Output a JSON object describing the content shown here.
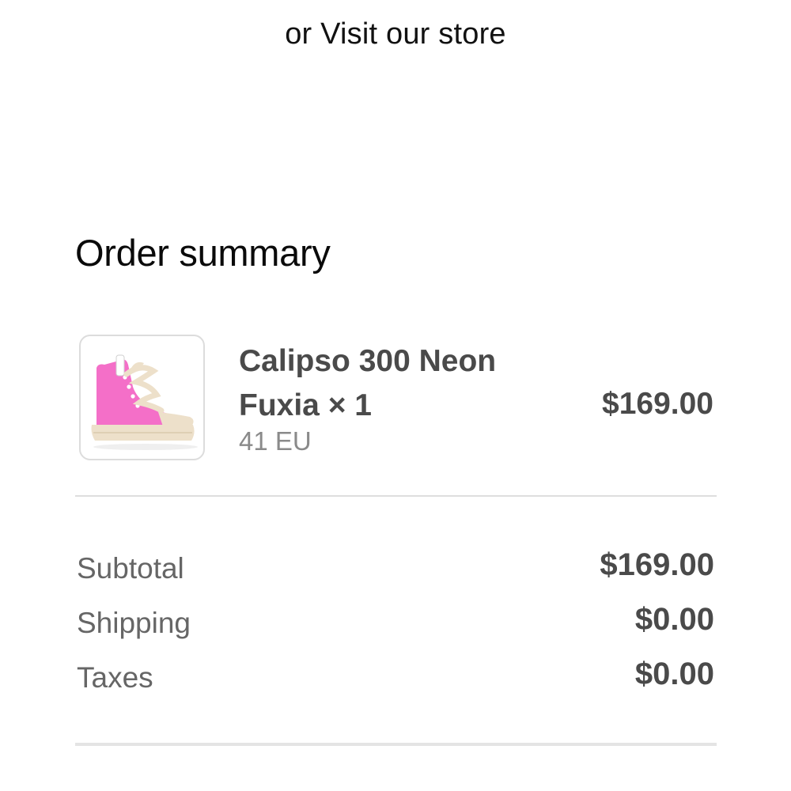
{
  "store_link": {
    "label": "or Visit our store"
  },
  "order_summary": {
    "title": "Order summary",
    "item": {
      "name": "Calipso 300 Neon Fuxia × 1",
      "variant": "41 EU",
      "price": "$169.00",
      "image_icon": "pink-high-top-sneaker-icon"
    },
    "totals": [
      {
        "label": "Subtotal",
        "value": "$169.00"
      },
      {
        "label": "Shipping",
        "value": "$0.00"
      },
      {
        "label": "Taxes",
        "value": "$0.00"
      }
    ]
  },
  "colors": {
    "primary_text": "#111111",
    "secondary_text": "#4a4a4a",
    "muted_text": "#8a8a8a",
    "divider": "#dedede",
    "sneaker_pink": "#f46fc8",
    "sneaker_sole": "#ede0ca"
  }
}
